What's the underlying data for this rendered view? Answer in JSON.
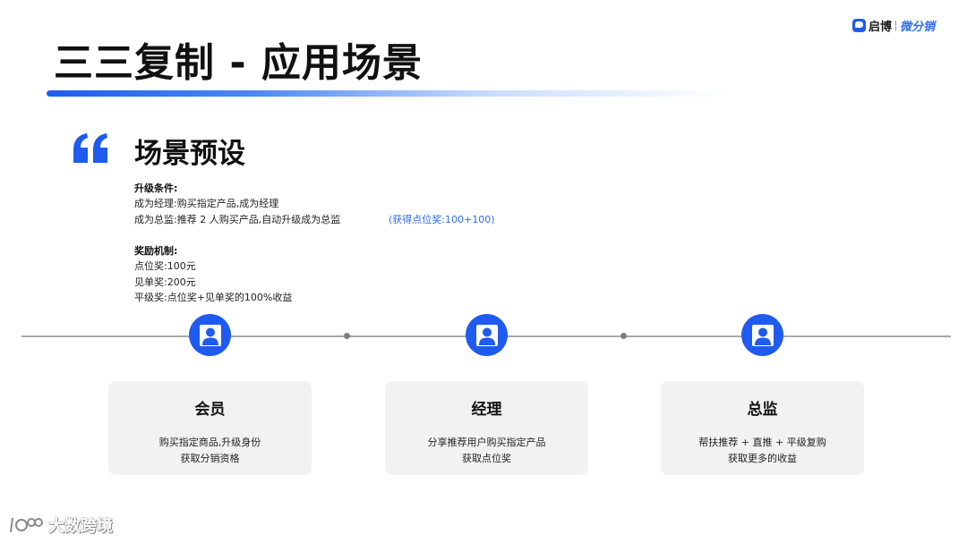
{
  "header": {
    "title": "三三复制 - 应用场景",
    "brand": {
      "name": "启博",
      "sub": "微分销"
    }
  },
  "section": {
    "heading": "场景预设",
    "upgrade": {
      "title": "升级条件:",
      "lines": [
        "成为经理:购买指定产品,成为经理",
        "成为总监:推荐 2 人购买产品,自动升级成为总监"
      ],
      "note": "(获得点位奖:100+100)"
    },
    "reward": {
      "title": "奖励机制:",
      "lines": [
        "点位奖:100元",
        "见单奖:200元",
        "平级奖:点位奖+见单奖的100%收益"
      ]
    }
  },
  "roles": [
    {
      "title": "会员",
      "desc": [
        "购买指定商品,升级身份",
        "获取分销资格"
      ]
    },
    {
      "title": "经理",
      "desc": [
        "分享推荐用户购买指定产品",
        "获取点位奖"
      ]
    },
    {
      "title": "总监",
      "desc": [
        "帮扶推荐 + 直推 + 平级复购",
        "获取更多的收益"
      ]
    }
  ],
  "watermark": {
    "text": "大数跨境"
  },
  "colors": {
    "accent": "#1f5bf0",
    "card_bg": "#f2f2f2",
    "note": "#2f6cf3"
  }
}
